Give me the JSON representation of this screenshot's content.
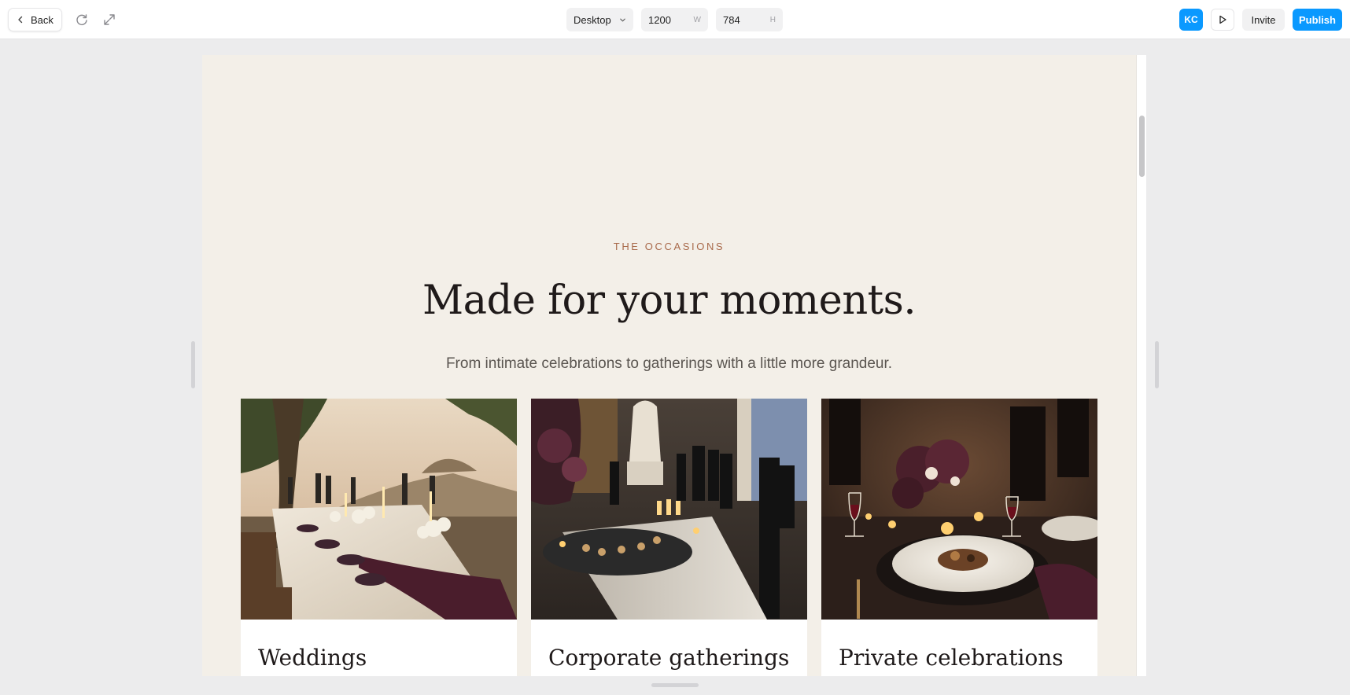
{
  "toolbar": {
    "back_label": "Back",
    "device": "Desktop",
    "width_value": "1200",
    "width_unit": "W",
    "height_value": "784",
    "height_unit": "H",
    "avatar_initials": "KC",
    "invite_label": "Invite",
    "publish_label": "Publish",
    "accent_color": "#0a99ff"
  },
  "section": {
    "eyebrow": "THE OCCASIONS",
    "headline": "Made for your moments.",
    "subhead": "From intimate celebrations to gatherings with a little more grandeur.",
    "background": "#f3efe8",
    "eyebrow_color": "#a8694a"
  },
  "cards": [
    {
      "title": "Weddings",
      "image": "outdoor-olive-grove-wedding-table"
    },
    {
      "title": "Corporate gatherings",
      "image": "gallery-reception-with-canapes"
    },
    {
      "title": "Private celebrations",
      "image": "candlelit-dinner-plate"
    }
  ]
}
